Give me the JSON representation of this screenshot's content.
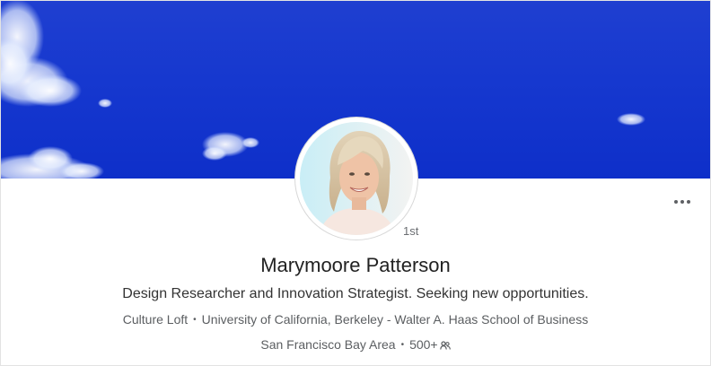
{
  "profile": {
    "name": "Marymoore Patterson",
    "degree": "1st",
    "headline": "Design Researcher and Innovation Strategist. Seeking new opportunities.",
    "company": "Culture Loft",
    "education": "University of California, Berkeley - Walter A. Haas School of Business",
    "location": "San Francisco Bay Area",
    "connections": "500+",
    "separator": "•"
  },
  "icons": {
    "overflow": "more-horizontal-icon",
    "connections": "people-icon"
  },
  "colors": {
    "cover_sky": "#1638cf",
    "text_primary": "#222222",
    "text_secondary": "#5b5e61"
  }
}
